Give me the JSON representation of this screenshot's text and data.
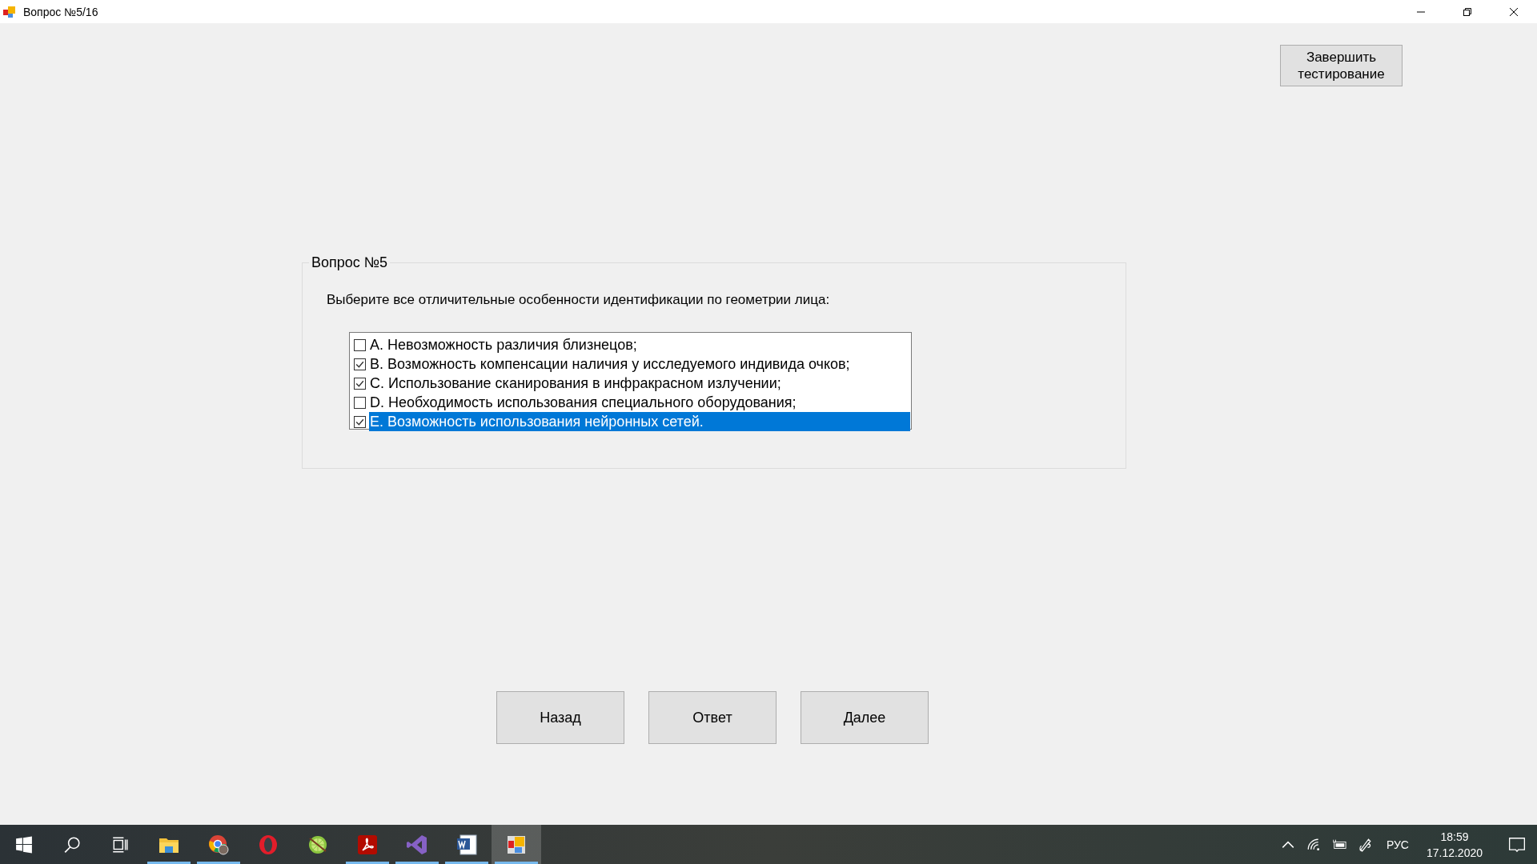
{
  "window": {
    "title": "Вопрос №5/16"
  },
  "finish_button": "Завершить тестирование",
  "question": {
    "title": "Вопрос №5",
    "text": "Выберите все отличительные особенности идентификации по геометрии лица:",
    "options": [
      {
        "label": "A. Невозможность различия близнецов;",
        "checked": false,
        "selected": false
      },
      {
        "label": "B. Возможность компенсации наличия у исследуемого индивида очков;",
        "checked": true,
        "selected": false
      },
      {
        "label": "C. Использование сканирования в инфракрасном излучении;",
        "checked": true,
        "selected": false
      },
      {
        "label": "D. Необходимость использования специального оборудования;",
        "checked": false,
        "selected": false
      },
      {
        "label": "E. Возможность использования нейронных сетей.",
        "checked": true,
        "selected": true
      }
    ]
  },
  "nav_buttons": [
    "Назад",
    "Ответ",
    "Далее"
  ],
  "taskbar": {
    "apps": [
      {
        "kind": "folder",
        "running": true,
        "selected": false
      },
      {
        "kind": "browser",
        "running": true,
        "selected": false
      },
      {
        "kind": "ring",
        "running": false,
        "selected": false
      },
      {
        "kind": "lime",
        "running": false,
        "selected": false
      },
      {
        "kind": "pdf",
        "running": true,
        "selected": false
      },
      {
        "kind": "studio",
        "running": true,
        "selected": false
      },
      {
        "kind": "word",
        "running": true,
        "selected": false
      },
      {
        "kind": "app",
        "running": true,
        "selected": true
      }
    ],
    "language": "РУС",
    "time": "18:59",
    "date": "17.12.2020"
  }
}
